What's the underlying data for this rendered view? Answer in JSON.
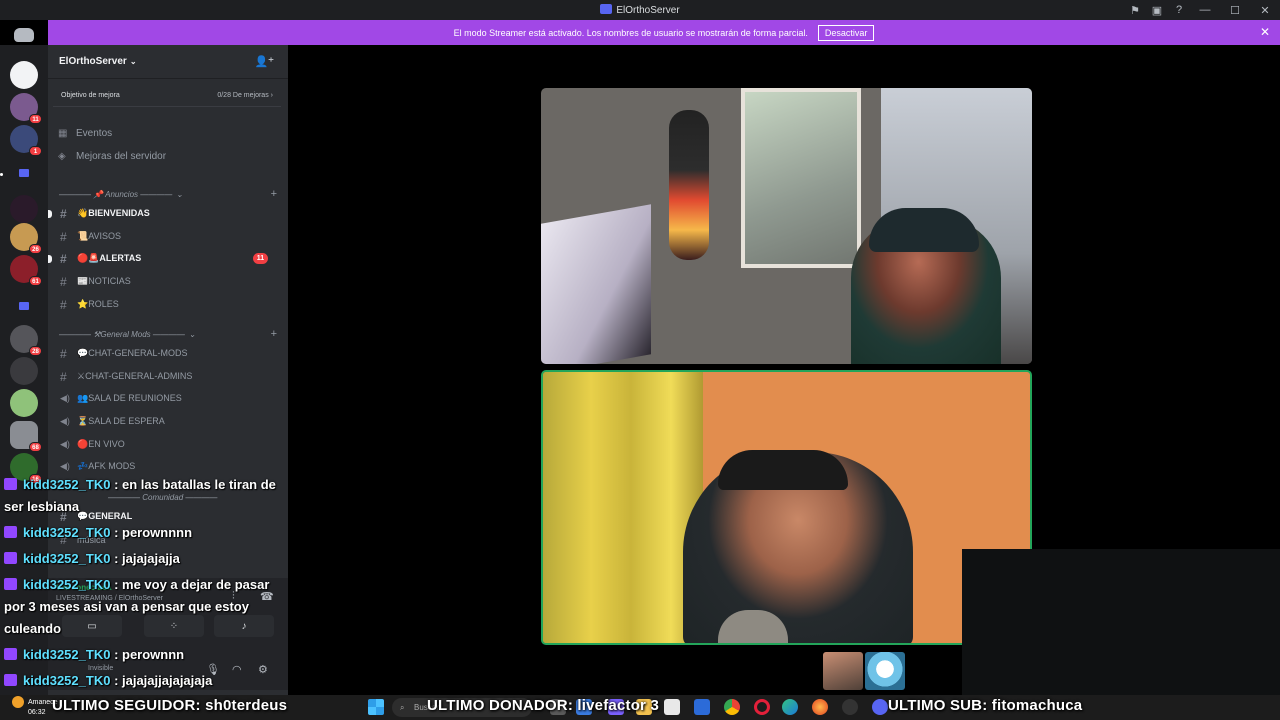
{
  "window": {
    "title": "ElOrthoServer"
  },
  "banner": {
    "text": "El modo Streamer está activado. Los nombres de usuario se mostrarán de forma parcial.",
    "button": "Desactivar"
  },
  "rail": {
    "badges": [
      "11",
      "1",
      "26",
      "61",
      "28",
      "68",
      "16"
    ]
  },
  "server": {
    "name": "ElOrthoServer",
    "boost_label": "Objetivo de mejora",
    "boost_progress": "0/28 De mejoras",
    "nav": [
      "Eventos",
      "Mejoras del servidor"
    ]
  },
  "categories": [
    {
      "label": "———— 📌 Anuncios ————"
    },
    {
      "label": "———— ⚒General Mods ————"
    },
    {
      "label": "———— Comunidad ————"
    }
  ],
  "channels": [
    {
      "name": "👋BIENVENIDAS",
      "type": "text",
      "unread": true
    },
    {
      "name": "📜AVISOS",
      "type": "text",
      "unread": false
    },
    {
      "name": "🔴🚨ALERTAS",
      "type": "text",
      "unread": true,
      "badge": "11"
    },
    {
      "name": "📰NOTICIAS",
      "type": "text",
      "unread": false
    },
    {
      "name": "⭐ROLES",
      "type": "text",
      "unread": false
    },
    {
      "name": "💬CHAT-GENERAL-MODS",
      "type": "text",
      "unread": false
    },
    {
      "name": "⚔CHAT-GENERAL-ADMINS",
      "type": "text",
      "unread": false
    },
    {
      "name": "👥SALA DE REUNIONES",
      "type": "voice",
      "unread": false
    },
    {
      "name": "⏳SALA DE ESPERA",
      "type": "voice",
      "unread": false
    },
    {
      "name": "🔴EN VIVO",
      "type": "voice",
      "unread": false
    },
    {
      "name": "💤AFK MODS",
      "type": "voice",
      "unread": false
    },
    {
      "name": "💬GENERAL",
      "type": "text",
      "unread": true
    },
    {
      "name": "música",
      "type": "text",
      "unread": false
    }
  ],
  "voice_panel": {
    "status": "Voz conectada",
    "sub": "LIVESTREAMING / ElOrthoServer"
  },
  "user_panel": {
    "status": "Invisible"
  },
  "chat": [
    {
      "user": "kidd3252_TK0",
      "text": ": en las batallas le tiran de ser lesbiana"
    },
    {
      "user": "kidd3252_TK0",
      "text": ": perownnnn"
    },
    {
      "user": "kidd3252_TK0",
      "text": ": jajajajajja"
    },
    {
      "user": "kidd3252_TK0",
      "text": ": me voy a dejar de pasar por 3 meses asi van a pensar que estoy culeando"
    },
    {
      "user": "kidd3252_TK0",
      "text": ": perownnn"
    },
    {
      "user": "kidd3252_TK0",
      "text": ": jajajajjajajajaja"
    }
  ],
  "taskbar": {
    "weather": "Amanece",
    "time": "06:32",
    "search": "Buscar"
  },
  "stream_labels": {
    "follower": "ULTIMO SEGUIDOR: sh0terdeus",
    "donor": "ULTIMO DONADOR: livefactor  3",
    "sub": "ULTIMO SUB: fitomachuca"
  },
  "colors": {
    "banner": "#a148e6",
    "speaking_border": "#23a55a",
    "chat_username": "#5fe0ff",
    "badge_red": "#f23f43"
  }
}
